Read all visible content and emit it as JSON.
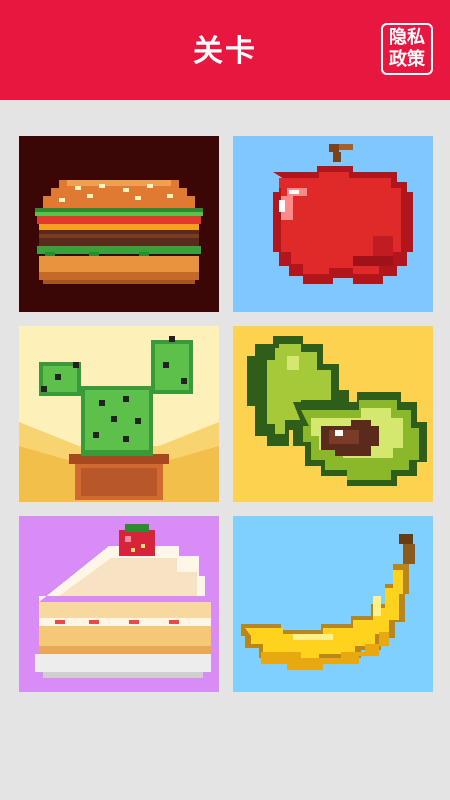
{
  "header": {
    "title": "关卡",
    "privacy_line1": "隐私",
    "privacy_line2": "政策"
  },
  "levels": [
    {
      "id": "burger",
      "icon": "burger-icon",
      "background": "#3a0706"
    },
    {
      "id": "apple",
      "icon": "apple-icon",
      "background": "#7fc7ff"
    },
    {
      "id": "cactus",
      "icon": "cactus-icon",
      "background": "#fdf0b8"
    },
    {
      "id": "avocado",
      "icon": "avocado-icon",
      "background": "#fdd24f"
    },
    {
      "id": "cake",
      "icon": "cake-icon",
      "background": "#d98cf5"
    },
    {
      "id": "banana",
      "icon": "banana-icon",
      "background": "#7fd0ff"
    }
  ],
  "colors": {
    "header": "#e8173f",
    "page_background": "#e4e4e4"
  }
}
